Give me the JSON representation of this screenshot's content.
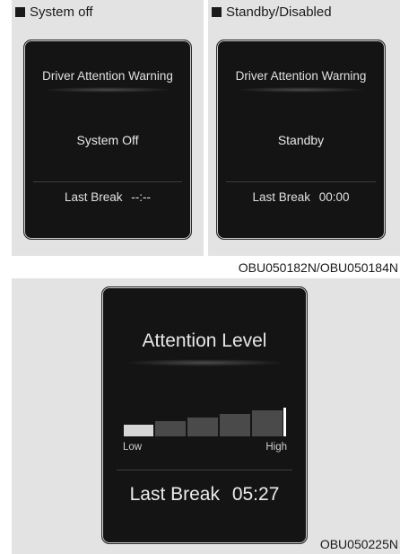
{
  "panels": {
    "system_off": {
      "caption": "System off",
      "screen_title": "Driver Attention Warning",
      "status": "System Off",
      "last_break_label": "Last Break",
      "last_break_value": "--:--"
    },
    "standby": {
      "caption": "Standby/Disabled",
      "screen_title": "Driver Attention Warning",
      "status": "Standby",
      "last_break_label": "Last Break",
      "last_break_value": "00:00"
    },
    "top_code": "OBU050182N/OBU050184N",
    "attention": {
      "title": "Attention Level",
      "low_label": "Low",
      "high_label": "High",
      "last_break_label": "Last Break",
      "last_break_value": "05:27",
      "segments_total": 5,
      "segments_filled": 1
    },
    "bottom_code": "OBU050225N"
  },
  "colors": {
    "panel_bg": "#e3e3e3",
    "screen_bg": "#141414",
    "screen_text": "#e6e6e6",
    "segment_on": "#d6d6d6",
    "segment_off": "#4a4a4a"
  }
}
